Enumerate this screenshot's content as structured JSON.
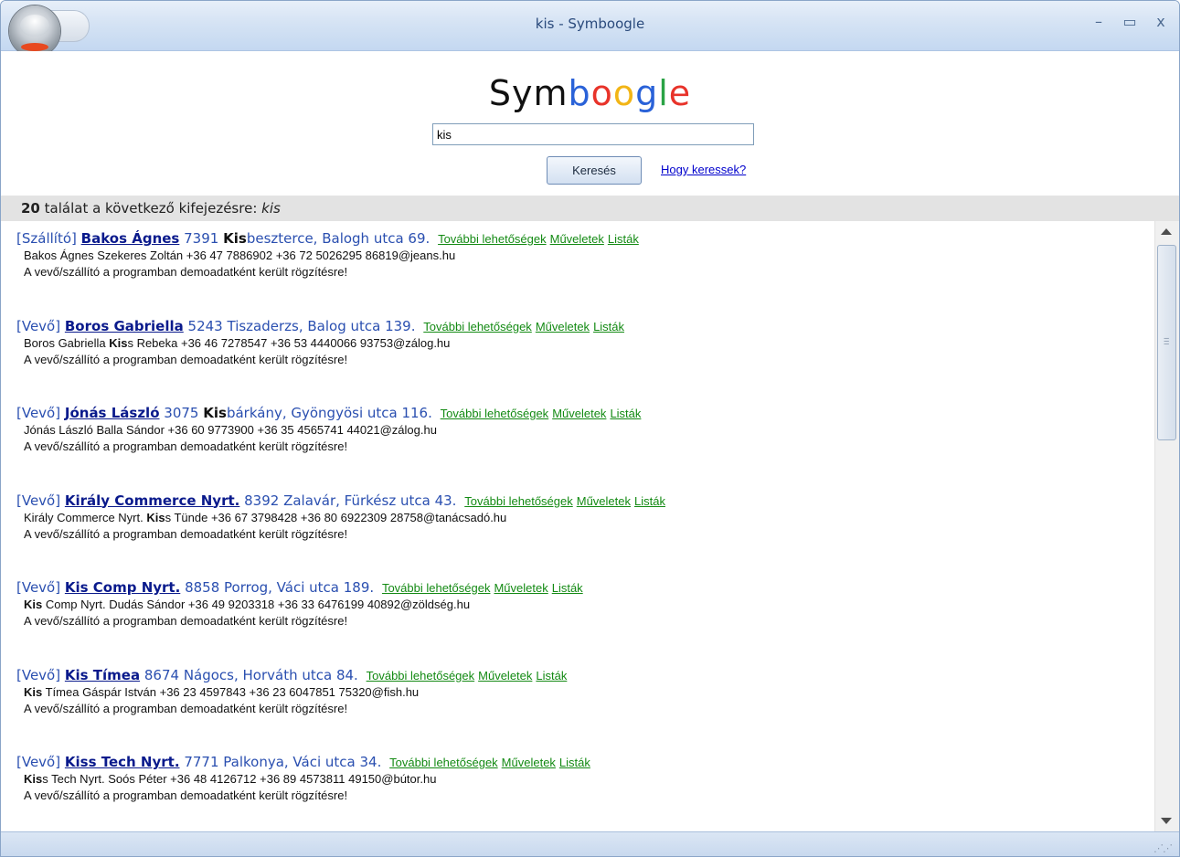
{
  "window": {
    "title": "kis - Symboogle"
  },
  "logo": {
    "parts": [
      {
        "text": "Sym",
        "color": "#111111"
      },
      {
        "text": "b",
        "color": "#2a62d8"
      },
      {
        "text": "o",
        "color": "#e8332a"
      },
      {
        "text": "o",
        "color": "#f2b516"
      },
      {
        "text": "g",
        "color": "#2a62d8"
      },
      {
        "text": "l",
        "color": "#2ba345"
      },
      {
        "text": "e",
        "color": "#e8332a"
      }
    ]
  },
  "search": {
    "value": "kis",
    "button_label": "Keresés",
    "help_link": "Hogy keressek?"
  },
  "results_summary": {
    "count": "20",
    "text": "találat a következő kifejezésre:",
    "term": "kis"
  },
  "links": {
    "more": "További lehetőségek",
    "actions": "Műveletek",
    "lists": "Listák"
  },
  "results": [
    {
      "type": "[Szállító]",
      "name": "Bakos Ágnes",
      "addr_pre": "7391",
      "addr_bold": "Kis",
      "addr_post": "beszterce, Balogh utca 69.",
      "detail_bold": "",
      "detail": "Bakos Ágnes Szekeres Zoltán +36 47 7886902 +36 72 5026295 86819@jeans.hu",
      "detail_pre": "",
      "note": "A vevő/szállító a programban demoadatként került rögzítésre!"
    },
    {
      "type": "[Vevő]",
      "name": "Boros Gabriella",
      "addr_pre": "5243 Tiszaderzs, Balog utca 139.",
      "addr_bold": "",
      "addr_post": "",
      "detail_pre": "Boros Gabriella ",
      "detail_bold": "Kis",
      "detail": "s Rebeka +36 46 7278547 +36 53 4440066 93753@zálog.hu",
      "note": "A vevő/szállító a programban demoadatként került rögzítésre!"
    },
    {
      "type": "[Vevő]",
      "name": "Jónás László",
      "addr_pre": "3075",
      "addr_bold": "Kis",
      "addr_post": "bárkány, Gyöngyösi utca 116.",
      "detail_pre": "",
      "detail_bold": "",
      "detail": "Jónás László Balla Sándor +36 60 9773900 +36 35 4565741 44021@zálog.hu",
      "note": "A vevő/szállító a programban demoadatként került rögzítésre!"
    },
    {
      "type": "[Vevő]",
      "name": "Király Commerce Nyrt.",
      "addr_pre": "8392 Zalavár, Fürkész utca 43.",
      "addr_bold": "",
      "addr_post": "",
      "detail_pre": "Király Commerce Nyrt. ",
      "detail_bold": "Kis",
      "detail": "s Tünde +36 67 3798428 +36 80 6922309 28758@tanácsadó.hu",
      "note": "A vevő/szállító a programban demoadatként került rögzítésre!"
    },
    {
      "type": "[Vevő]",
      "name": "Kis Comp Nyrt.",
      "addr_pre": "8858 Porrog, Váci utca 189.",
      "addr_bold": "",
      "addr_post": "",
      "detail_pre": "",
      "detail_bold": "Kis",
      "detail": " Comp Nyrt. Dudás Sándor +36 49 9203318 +36 33 6476199 40892@zöldség.hu",
      "note": "A vevő/szállító a programban demoadatként került rögzítésre!"
    },
    {
      "type": "[Vevő]",
      "name": "Kis Tímea",
      "addr_pre": "8674 Nágocs, Horváth utca 84.",
      "addr_bold": "",
      "addr_post": "",
      "detail_pre": "",
      "detail_bold": "Kis",
      "detail": " Tímea Gáspár István +36 23 4597843 +36 23 6047851 75320@fish.hu",
      "note": "A vevő/szállító a programban demoadatként került rögzítésre!"
    },
    {
      "type": "[Vevő]",
      "name": "Kiss Tech Nyrt.",
      "addr_pre": "7771 Palkonya, Váci utca 34.",
      "addr_bold": "",
      "addr_post": "",
      "detail_pre": "",
      "detail_bold": "Kis",
      "detail": "s Tech Nyrt. Soós Péter +36 48 4126712 +36 89 4573811 49150@bútor.hu",
      "note": "A vevő/szállító a programban demoadatként került rögzítésre!"
    }
  ]
}
